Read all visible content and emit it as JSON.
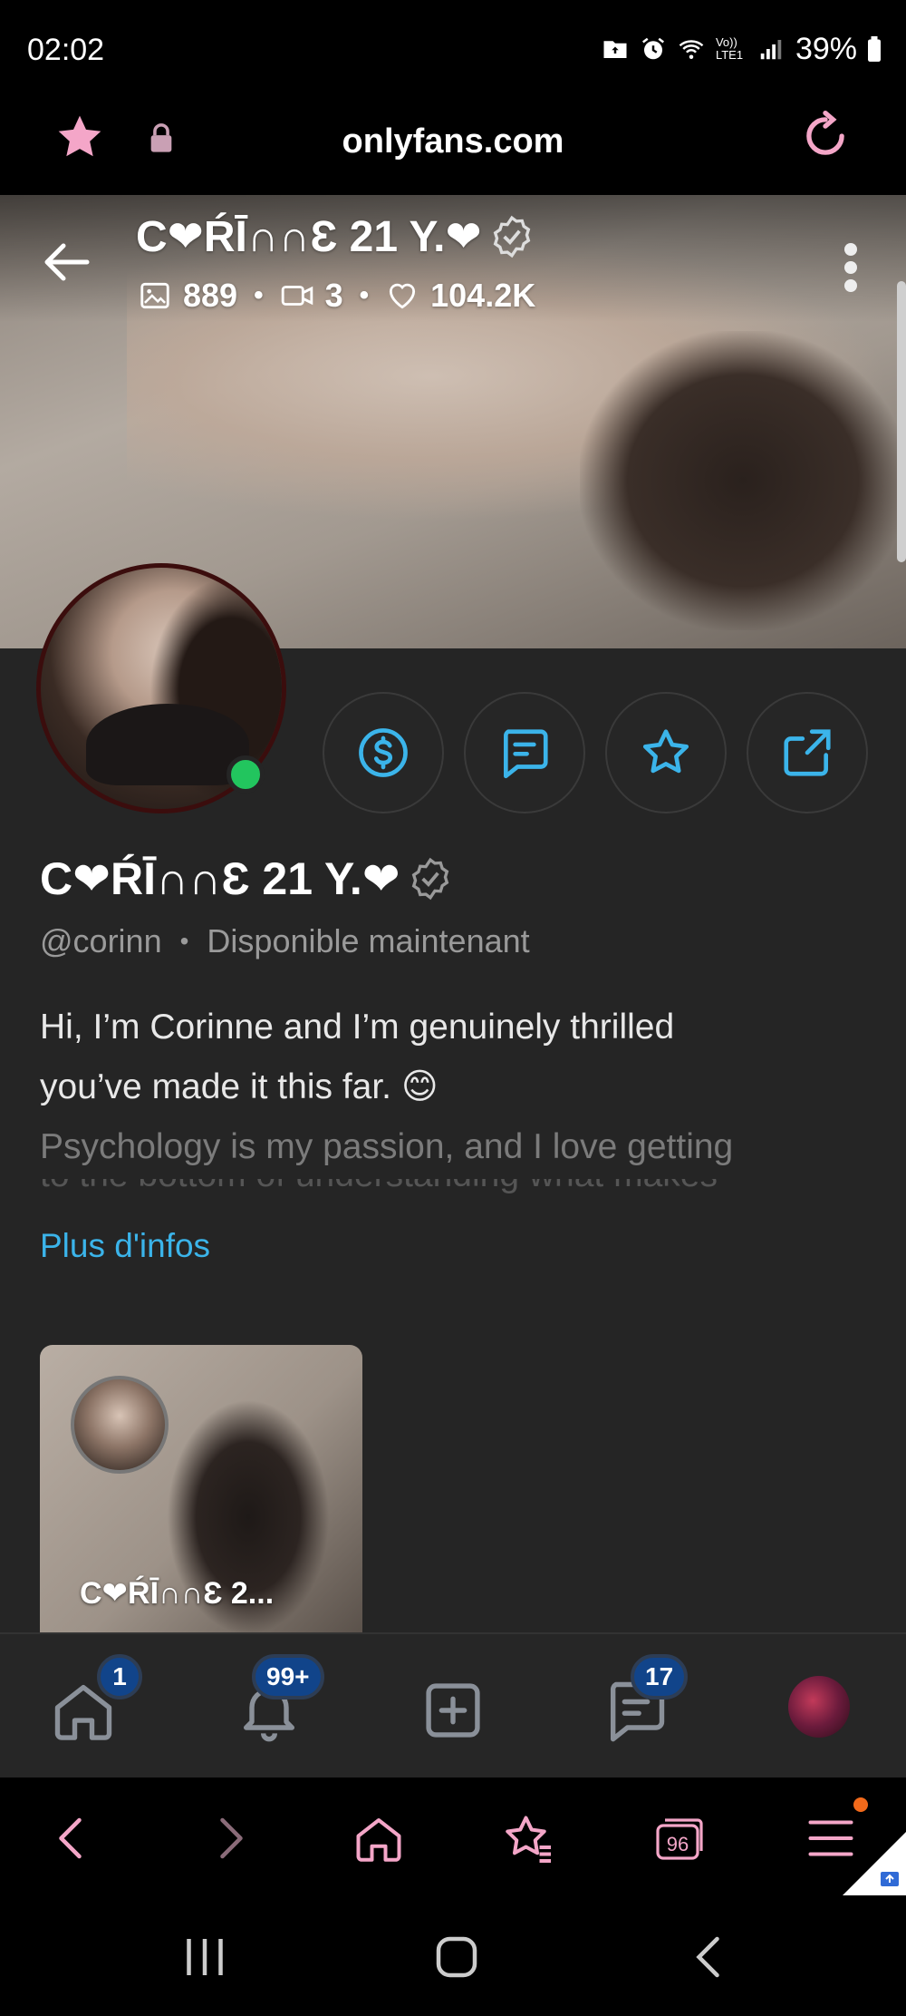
{
  "status_bar": {
    "time": "02:02",
    "network_label": "Vo)) LTE1",
    "battery": "39%"
  },
  "browser": {
    "url": "onlyfans.com",
    "icons": [
      "favorite-star-icon",
      "lock-icon",
      "reload-icon"
    ],
    "accent_color": "#f4a6c8"
  },
  "profile_header": {
    "title": "C❤ŔĪ∩∩Ɛ 21 Y.❤",
    "stats": {
      "photos": "889",
      "videos": "3",
      "likes": "104.2K"
    }
  },
  "profile": {
    "display_name": "C❤ŔĪ∩∩Ɛ 21 Y.❤",
    "handle": "@corinn",
    "availability": "Disponible maintenant",
    "bio_line1": "Hi, I’m Corinne and I’m genuinely thrilled",
    "bio_line2": "you’ve made it this far. 😊",
    "bio_line3": "Psychology is my passion, and I love getting",
    "bio_line4": "to the bottom of understanding what makes",
    "more_link": "Plus d'infos",
    "accent_color": "#3bb4ea",
    "online_color": "#22c55e"
  },
  "actions": [
    "tip-icon",
    "message-icon",
    "favorite-icon",
    "share-icon"
  ],
  "story": {
    "name": "C❤ŔĪ∩∩Ɛ 2..."
  },
  "app_nav": {
    "home_badge": "1",
    "notifications_badge": "99+",
    "messages_badge": "17"
  },
  "browser_toolbar": {
    "tabs_count": "96"
  }
}
